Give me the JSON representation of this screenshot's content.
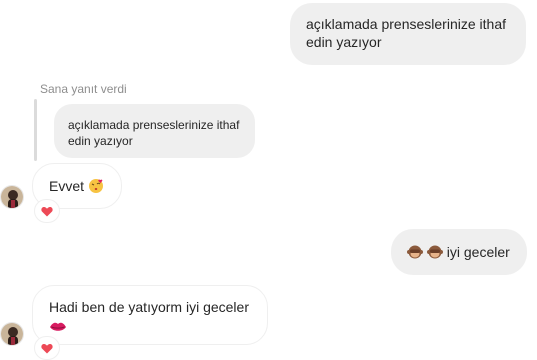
{
  "messages": {
    "out_1": "açıklamada prenseslerinize ithaf edin yazıyor",
    "reply_label": "Sana yanıt verdi",
    "quoted_text": "açıklamada prenseslerinize ithaf edin yazıyor",
    "in_1": "Evvet",
    "out_2_text": "iyi geceler",
    "in_2": "Hadi ben de yatıyorm iyi geceler"
  },
  "icons": {
    "reaction": "red-heart-icon",
    "kiss_emoji": "kissing-heart-emoji",
    "monkey_emoji": "see-no-evil-monkey-emoji",
    "lips_emoji": "kiss-mark-emoji"
  },
  "colors": {
    "outgoing_bubble": "#efefef",
    "incoming_border": "#efefef",
    "heart": "#ed4956",
    "meta_text": "#8e8e8e"
  }
}
